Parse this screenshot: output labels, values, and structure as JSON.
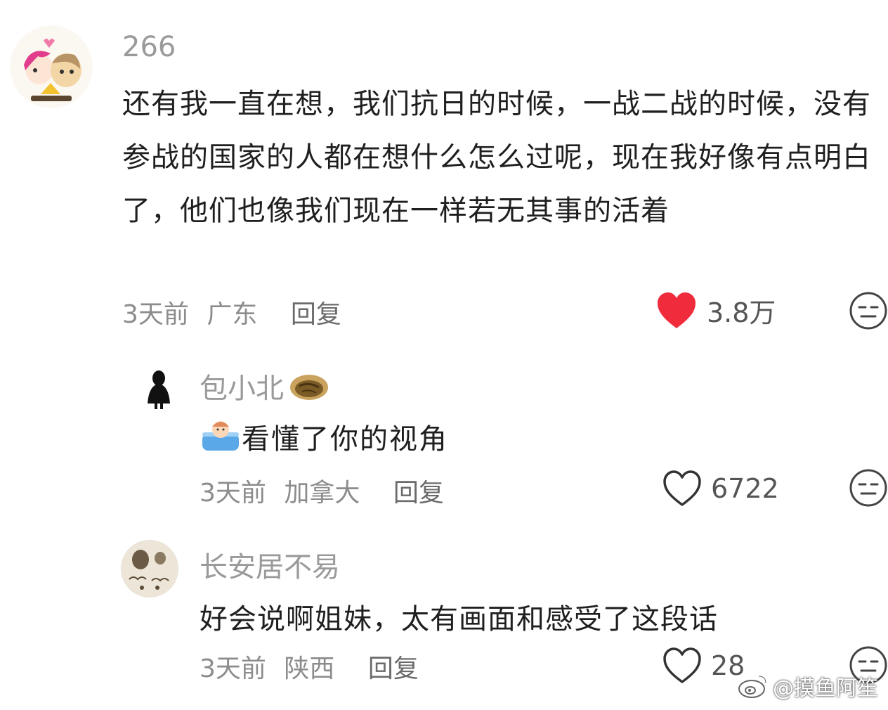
{
  "comments": [
    {
      "username": "266",
      "text": "还有我一直在想，我们抗日的时候，一战二战的时候，没有参战的国家的人都在想什么怎么过呢，现在我好像有点明白了，他们也像我们现在一样若无其事的活着",
      "time": "3天前",
      "location": "广东",
      "reply_label": "回复",
      "likes": "3.8万",
      "liked": true,
      "avatar_icon": "cartoon-couple-avatar"
    },
    {
      "username": "包小北",
      "username_emoji": "walnut-icon",
      "text_emoji": "bathtub-emoji",
      "text": "看懂了你的视角",
      "time": "3天前",
      "location": "加拿大",
      "reply_label": "回复",
      "likes": "6722",
      "liked": false,
      "avatar_icon": "black-figure-avatar"
    },
    {
      "username": "长安居不易",
      "text": "好会说啊姐妹，太有画面和感受了这段话",
      "time": "3天前",
      "location": "陕西",
      "reply_label": "回复",
      "likes": "28",
      "liked": false,
      "avatar_icon": "sketch-avatar"
    }
  ],
  "watermark": {
    "text": "@摸鱼阿笙",
    "icon": "weibo-logo-icon"
  },
  "colors": {
    "heart_active": "#f02b3c",
    "username": "#9a9a9a",
    "meta": "#8c8c8c"
  }
}
